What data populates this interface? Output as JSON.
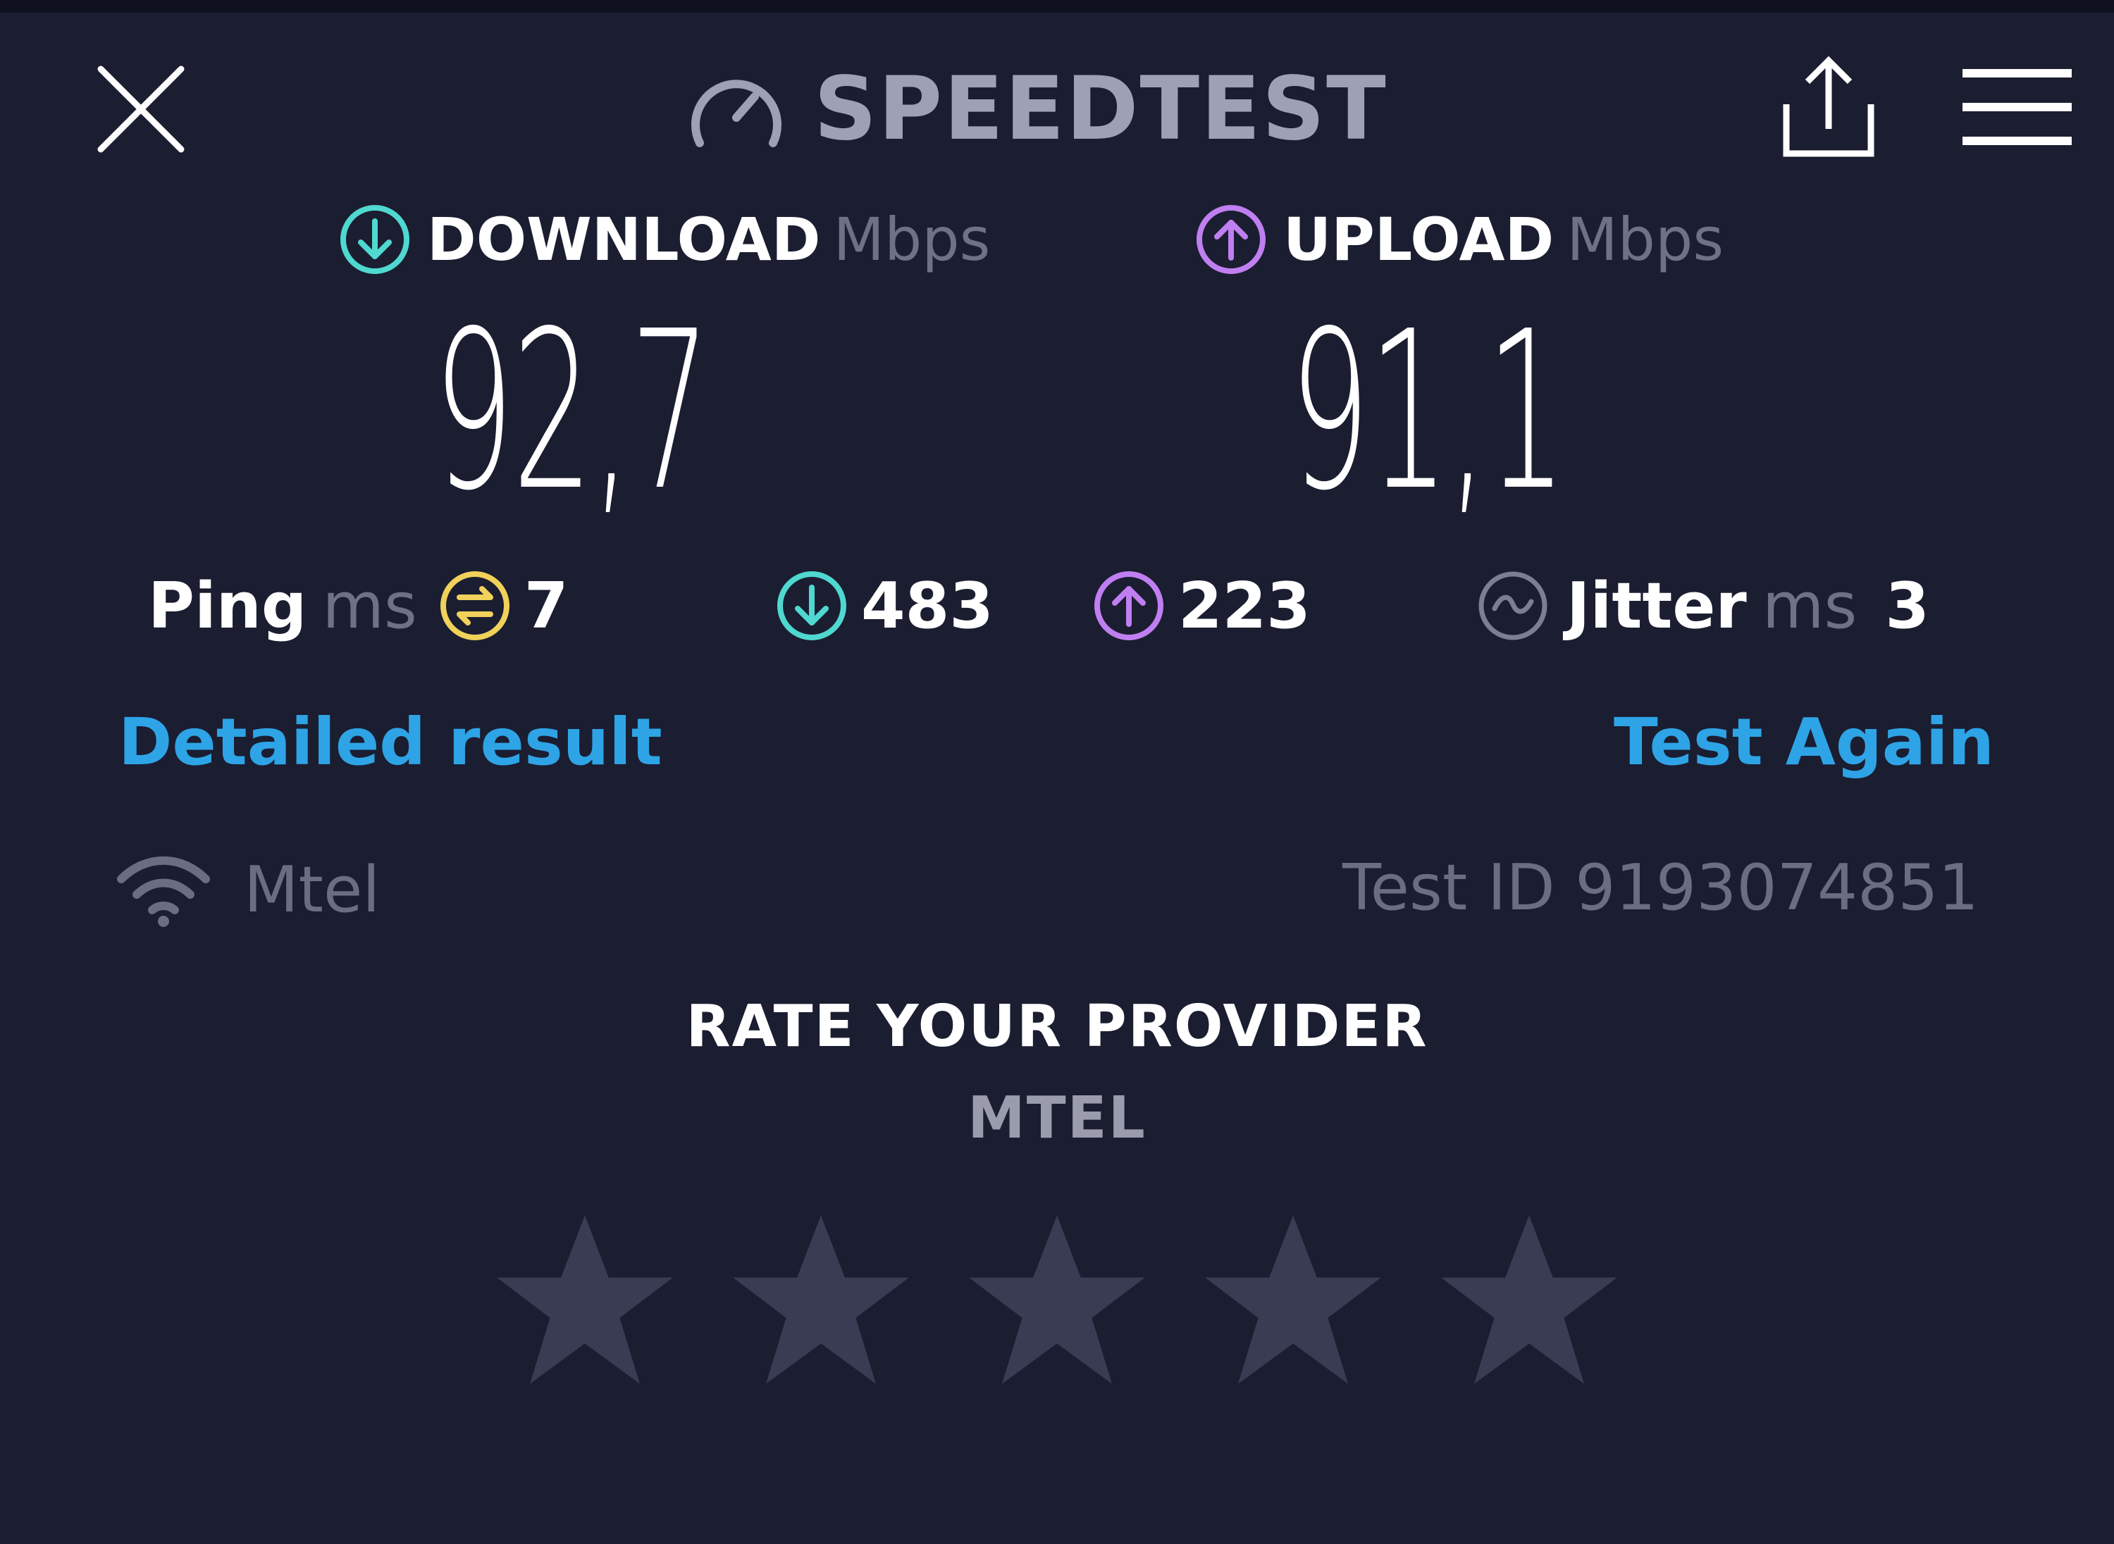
{
  "header": {
    "brand": "SPEEDTEST",
    "close_icon": "close-icon",
    "share_icon": "share-icon",
    "menu_icon": "hamburger-menu-icon"
  },
  "download": {
    "label": "DOWNLOAD",
    "unit": "Mbps",
    "value": "92,7",
    "color": "#4fd8cf"
  },
  "upload": {
    "label": "UPLOAD",
    "unit": "Mbps",
    "value": "91,1",
    "color": "#c07ff0"
  },
  "stats": {
    "ping": {
      "label": "Ping",
      "unit": "ms",
      "value": "7",
      "color": "#f0d15a"
    },
    "download_latency": {
      "value": "483"
    },
    "upload_latency": {
      "value": "223"
    },
    "jitter": {
      "label": "Jitter",
      "unit": "ms",
      "value": "3"
    }
  },
  "actions": {
    "detailed_result": "Detailed result",
    "test_again": "Test Again"
  },
  "connection": {
    "provider": "Mtel",
    "test_id": "Test ID 9193074851"
  },
  "rating": {
    "title": "RATE YOUR PROVIDER",
    "provider": "MTEL",
    "stars_total": 5,
    "stars_selected": 0
  },
  "colors": {
    "background": "#1b1d31",
    "accent_link": "#2ea4e6",
    "muted": "#6b6d80",
    "star": "#3a3c54"
  }
}
